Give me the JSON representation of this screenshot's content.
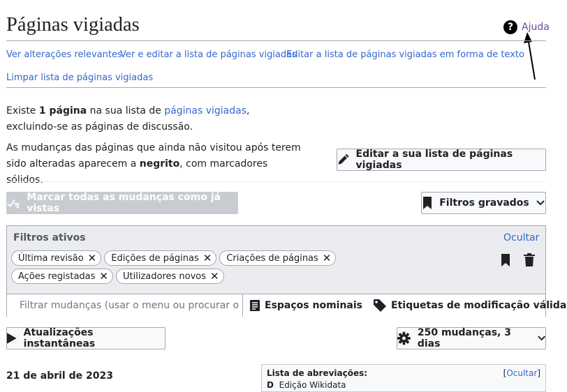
{
  "page": {
    "title": "Páginas vigiadas",
    "help": {
      "label": "Ajuda",
      "icon": "help-icon"
    }
  },
  "links": {
    "relevant_changes": "Ver alterações relevantes",
    "view_edit_list": "Ver e editar a lista de páginas vigiadas",
    "edit_raw": "Editar a lista de páginas vigiadas em forma de texto",
    "clear_list": "Limpar lista de páginas vigiadas"
  },
  "intro": {
    "p1_before": "Existe ",
    "p1_bold": "1 página",
    "p1_mid": " na sua lista de ",
    "p1_link": "páginas vigiadas",
    "p1_after": ", excluindo-se as páginas de discussão.",
    "p2_before": "As mudanças das páginas que ainda não visitou após terem sido alteradas aparecem a ",
    "p2_bold": "negrito",
    "p2_after": ", com marcadores sólidos."
  },
  "buttons": {
    "edit_list": "Editar a sua lista de páginas vigiadas",
    "mark_all_seen": "Marcar todas as mudanças como já vistas",
    "saved_filters": "Filtros gravados",
    "live_updates": "Atualizações instantâneas",
    "changes_limit": "250 mudanças, 3 dias"
  },
  "filters": {
    "title": "Filtros ativos",
    "hide": "Ocultar",
    "tags": [
      "Última revisão",
      "Edições de páginas",
      "Criações de páginas",
      "Ações registadas",
      "Utilizadores novos"
    ],
    "search_placeholder": "Filtrar mudanças (usar o menu ou procurar o nome do filtro)",
    "namespaces": "Espaços nominais",
    "change_tags": "Etiquetas de modificação válidas"
  },
  "results": {
    "date_heading": "21 de abril de 2023",
    "legend_title": "Lista de abreviações:",
    "legend_hide": "Ocultar",
    "legend_item_key": "D",
    "legend_item_text": "Edição Wikidata"
  },
  "colors": {
    "link": "#3366cc",
    "visited_link": "#6b4ba1",
    "border": "#a2a9b1",
    "panel_bg": "#eaecf0",
    "disabled_bg": "#c8ccd1"
  }
}
